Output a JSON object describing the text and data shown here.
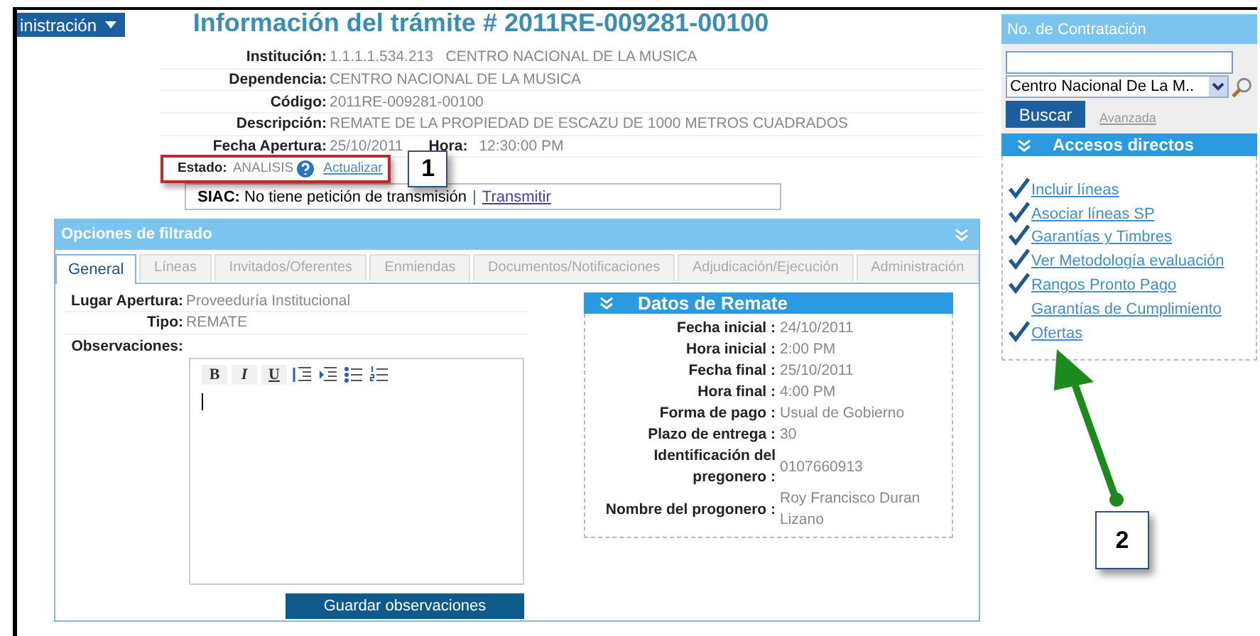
{
  "menu_button": {
    "label": "inistración"
  },
  "title": "Información del trámite # 2011RE-009281-00100",
  "fields": [
    {
      "label": "Institución:",
      "value": "1.1.1.1.534.213   CENTRO NACIONAL DE LA MUSICA"
    },
    {
      "label": "Dependencia:",
      "value": "CENTRO NACIONAL DE LA MUSICA"
    },
    {
      "label": "Código:",
      "value": "2011RE-009281-00100"
    },
    {
      "label": "Descripción:",
      "value": "REMATE DE LA PROPIEDAD DE ESCAZU DE 1000 METROS CUADRADOS"
    },
    {
      "label": "Fecha Apertura:",
      "value": "25/10/2011",
      "extra_label": "Hora:",
      "extra_value": "12:30:00 PM"
    }
  ],
  "estado": {
    "label": "Estado:",
    "value": "ANALISIS",
    "link": "Actualizar"
  },
  "siac": {
    "label": "SIAC:",
    "text": "No tiene petición de transmisión",
    "separator": "|",
    "link": "Transmitir"
  },
  "filter_panel": {
    "title": "Opciones de filtrado",
    "tabs": [
      {
        "label": "General",
        "selected": true
      },
      {
        "label": "Líneas",
        "selected": false
      },
      {
        "label": "Invitados/Oferentes",
        "selected": false
      },
      {
        "label": "Enmiendas",
        "selected": false
      },
      {
        "label": "Documentos/Notificaciones",
        "selected": false
      },
      {
        "label": "Adjudicación/Ejecución",
        "selected": false
      },
      {
        "label": "Administración",
        "selected": false
      }
    ],
    "fields": [
      {
        "label": "Lugar Apertura:",
        "value": "Proveeduría Institucional"
      },
      {
        "label": "Tipo:",
        "value": "REMATE"
      }
    ],
    "observaciones": {
      "label": "Observaciones:",
      "toolbar": [
        "B",
        "I",
        "U"
      ]
    },
    "save_button": "Guardar observaciones",
    "datos_remate": {
      "title": "Datos de Remate",
      "rows": [
        {
          "label": "Fecha inicial :",
          "value": "24/10/2011"
        },
        {
          "label": "Hora inicial :",
          "value": "2:00 PM"
        },
        {
          "label": "Fecha final :",
          "value": "25/10/2011"
        },
        {
          "label": "Hora final :",
          "value": "4:00 PM"
        },
        {
          "label": "Forma de pago :",
          "value": "Usual de Gobierno"
        },
        {
          "label": "Plazo de entrega :",
          "value": "30"
        },
        {
          "label": "Identificación del pregonero :",
          "value": "0107660913"
        },
        {
          "label": "Nombre del progonero :",
          "value": "Roy Francisco Duran Lizano"
        }
      ]
    }
  },
  "sidebar": {
    "search": {
      "title": "No. de Contratación",
      "select_value": "Centro Nacional De La M..",
      "button": "Buscar",
      "link": "Avanzada"
    },
    "accesos": {
      "title": "Accesos directos",
      "links": [
        {
          "label": "Incluir líneas",
          "checked": true
        },
        {
          "label": "Asociar líneas SP",
          "checked": true
        },
        {
          "label": "Garantías y Timbres",
          "checked": true
        },
        {
          "label": "Ver Metodología evaluación",
          "checked": true
        },
        {
          "label": "Rangos Pronto Pago",
          "checked": true
        },
        {
          "label": "Garantías de Cumplimiento",
          "checked": false
        },
        {
          "label": "Ofertas",
          "checked": true
        }
      ]
    }
  },
  "annotations": [
    {
      "label": "1"
    },
    {
      "label": "2"
    }
  ]
}
